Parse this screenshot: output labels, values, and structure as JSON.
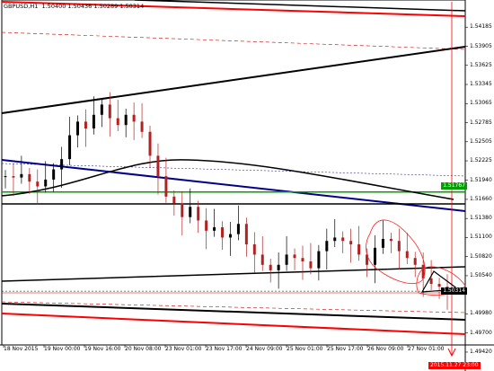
{
  "header": {
    "symbol": "GBPUSD,H1",
    "ohlc": "1.50400 1.50436 1.50289 1.50314"
  },
  "price_axis": [
    "1.54185",
    "1.53905",
    "1.53625",
    "1.53345",
    "1.53065",
    "1.52785",
    "1.52505",
    "1.52225",
    "1.51940",
    "1.51660",
    "1.51380",
    "1.51100",
    "1.50820",
    "1.50540",
    "1.49980",
    "1.49700",
    "1.49420"
  ],
  "time_axis": [
    "18 Nov 2015",
    "19 Nov 00:00",
    "19 Nov 16:00",
    "20 Nov 08:00",
    "23 Nov 01:00",
    "23 Nov 17:00",
    "24 Nov 09:00",
    "25 Nov 01:00",
    "25 Nov 17:00",
    "26 Nov 09:00",
    "27 Nov 01:00"
  ],
  "tags": {
    "green_level": "1.51767",
    "current_price": "1.50314",
    "cursor_time": "2015.11.27 23:00"
  },
  "colors": {
    "background": "#ffffff",
    "candle_up": "#000000",
    "candle_down": "#b22222",
    "trend_black": "#000000",
    "trend_red": "#ff0000",
    "ma_blue": "#00008b",
    "level_green": "#00a000"
  },
  "chart_data": {
    "type": "candlestick",
    "symbol": "GBPUSD",
    "timeframe": "H1",
    "ylim": [
      1.4938,
      1.5432
    ],
    "y_ticks": [
      1.54185,
      1.53905,
      1.53625,
      1.53345,
      1.53065,
      1.52785,
      1.52505,
      1.52225,
      1.5194,
      1.5166,
      1.5138,
      1.511,
      1.5082,
      1.5054,
      1.4998,
      1.497,
      1.4942
    ],
    "close_path": [
      1.52,
      1.5198,
      1.5203,
      1.5192,
      1.5185,
      1.5195,
      1.521,
      1.5225,
      1.526,
      1.528,
      1.527,
      1.529,
      1.5305,
      1.5285,
      1.5275,
      1.529,
      1.528,
      1.5265,
      1.523,
      1.52,
      1.517,
      1.516,
      1.514,
      1.5155,
      1.5135,
      1.512,
      1.5125,
      1.511,
      1.5115,
      1.513,
      1.51,
      1.5085,
      1.507,
      1.5062,
      1.507,
      1.5085,
      1.508,
      1.5075,
      1.5065,
      1.509,
      1.5105,
      1.511,
      1.5105,
      1.51,
      1.5085,
      1.507,
      1.5095,
      1.5108,
      1.5105,
      1.509,
      1.508,
      1.507,
      1.505,
      1.5042,
      1.5038,
      1.5031
    ],
    "levels": {
      "green": 1.51767,
      "current": 1.50314
    }
  }
}
